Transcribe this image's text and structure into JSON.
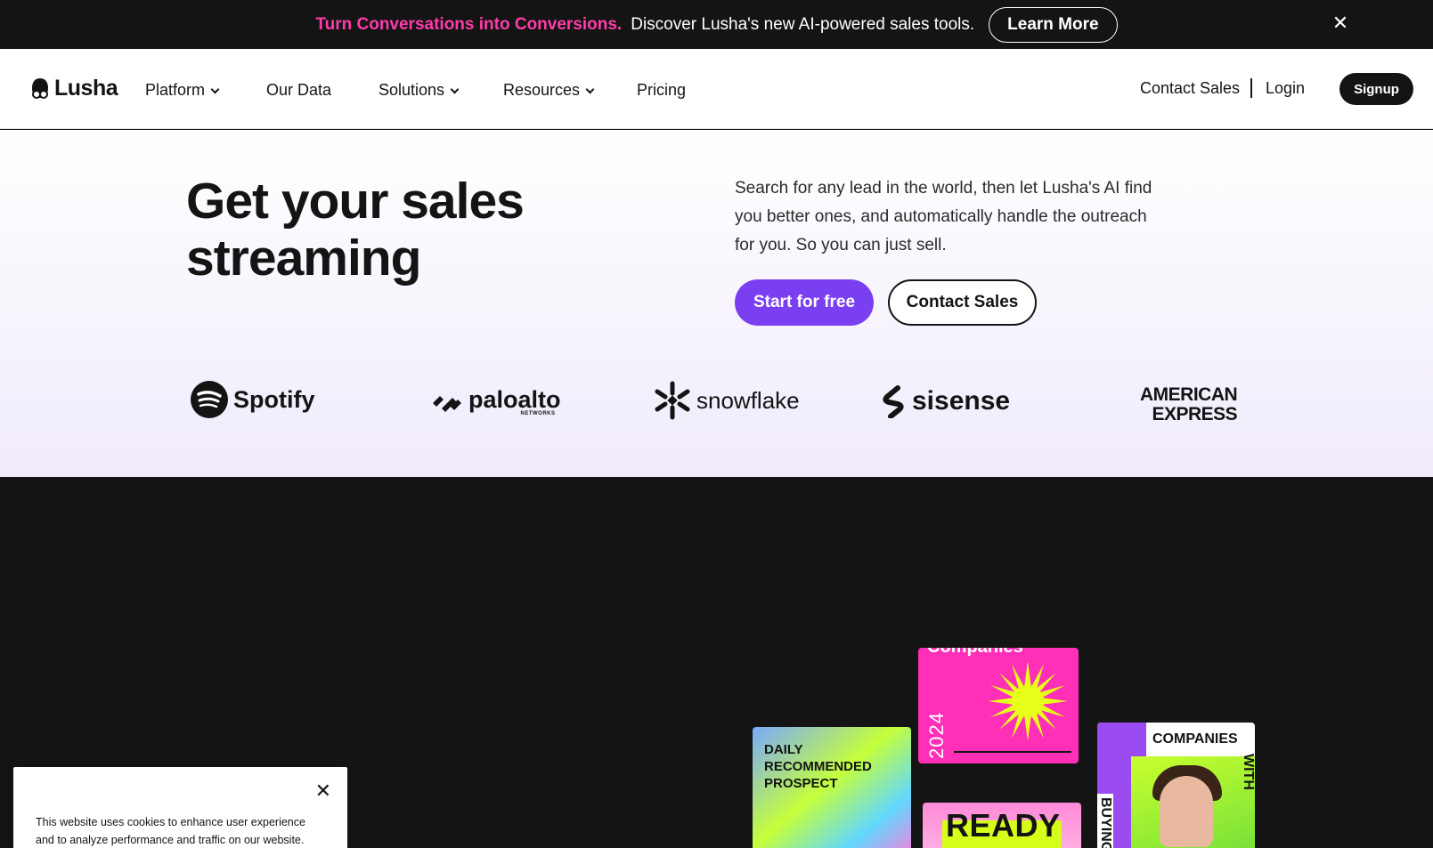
{
  "announcement": {
    "highlight": "Turn Conversations into Conversions.",
    "message": "Discover Lusha's new AI-powered sales tools.",
    "cta": "Learn More",
    "close_icon": "close-icon"
  },
  "nav": {
    "logo": "Lusha",
    "items": [
      {
        "label": "Platform",
        "dropdown": true
      },
      {
        "label": "Our Data",
        "dropdown": false
      },
      {
        "label": "Solutions",
        "dropdown": true
      },
      {
        "label": "Resources",
        "dropdown": true
      },
      {
        "label": "Pricing",
        "dropdown": false
      }
    ],
    "contact_sales": "Contact Sales",
    "login": "Login",
    "signup": "Signup"
  },
  "hero": {
    "title": "Get your sales streaming",
    "description": "Search for any lead in the world, then let Lusha's AI find you better ones, and automatically handle the outreach for you. So you can just sell.",
    "primary_cta": "Start for free",
    "secondary_cta": "Contact Sales"
  },
  "customer_logos": {
    "spotify": "Spotify",
    "paloalto": "paloalto",
    "paloalto_sub": "NETWORKS",
    "snowflake": "snowflake",
    "sisense": "sisense",
    "amex_line1": "AMERICAN",
    "amex_line2": "EXPRESS"
  },
  "cards": {
    "daily": "DAILY RECOMMENDED PROSPECT",
    "companies_top": "Companies",
    "year": "2024",
    "ready": "READY",
    "companies": "COMPANIES",
    "with": "WITH",
    "buying": "BUYING"
  },
  "cookie": {
    "text": "This website uses cookies to enhance user experience and to analyze performance and traffic on our website."
  },
  "colors": {
    "accent_pink": "#ff3cab",
    "primary_purple": "#7b3ff2",
    "dark": "#141414"
  }
}
